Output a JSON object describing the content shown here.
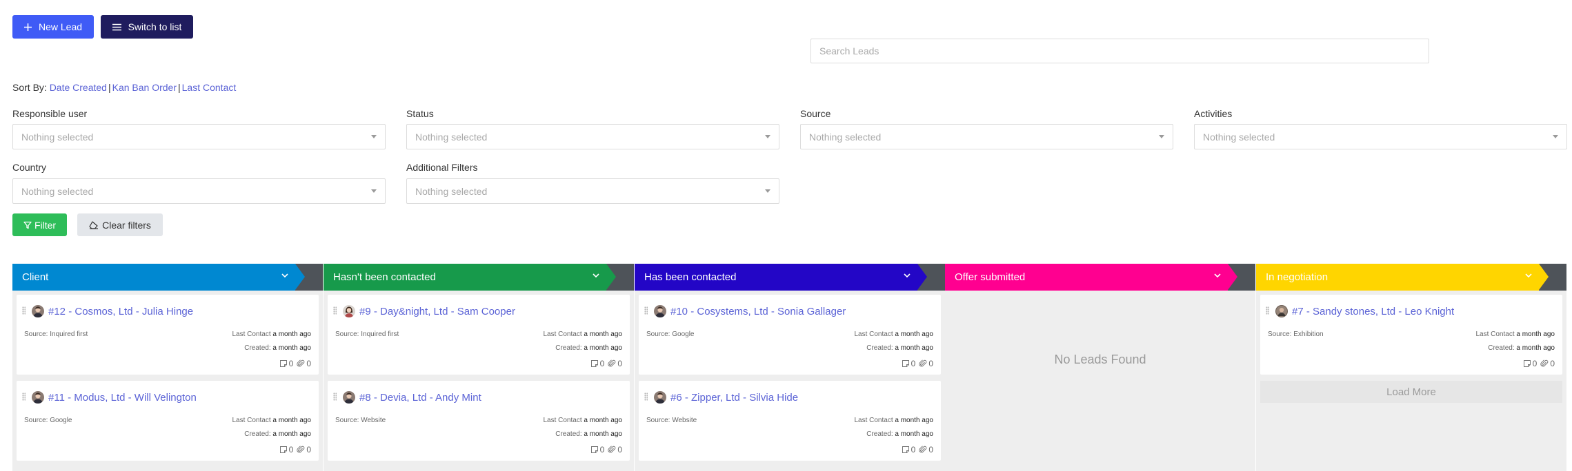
{
  "toolbar": {
    "new_lead_label": "New Lead",
    "switch_list_label": "Switch to list"
  },
  "search": {
    "placeholder": "Search Leads"
  },
  "sort": {
    "prefix": "Sort By:",
    "options": [
      "Date Created",
      "Kan Ban Order",
      "Last Contact"
    ],
    "separator": "|"
  },
  "filters": {
    "responsible_user": {
      "label": "Responsible user",
      "value": "Nothing selected"
    },
    "status": {
      "label": "Status",
      "value": "Nothing selected"
    },
    "source": {
      "label": "Source",
      "value": "Nothing selected"
    },
    "activities": {
      "label": "Activities",
      "value": "Nothing selected"
    },
    "country": {
      "label": "Country",
      "value": "Nothing selected"
    },
    "additional": {
      "label": "Additional Filters",
      "value": "Nothing selected"
    },
    "filter_label": "Filter",
    "clear_label": "Clear filters"
  },
  "card_labels": {
    "last_contact": "Last Contact",
    "created": "Created:"
  },
  "columns": [
    {
      "title": "Client",
      "color": "#0088d1",
      "leads": [
        {
          "title": "#12 - Cosmos, Ltd - Julia Hinge",
          "source": "Source: Inquired first",
          "last_contact": "a month ago",
          "created": "a month ago",
          "notes": "0",
          "attachments": "0",
          "avatar": "male"
        },
        {
          "title": "#11 - Modus, Ltd - Will Velington",
          "source": "Source: Google",
          "last_contact": "a month ago",
          "created": "a month ago",
          "notes": "0",
          "attachments": "0",
          "avatar": "male"
        }
      ]
    },
    {
      "title": "Hasn't been contacted",
      "color": "#179a4b",
      "leads": [
        {
          "title": "#9 - Day&night, Ltd - Sam Cooper",
          "source": "Source: Inquired first",
          "last_contact": "a month ago",
          "created": "a month ago",
          "notes": "0",
          "attachments": "0",
          "avatar": "female"
        },
        {
          "title": "#8 - Devia, Ltd - Andy Mint",
          "source": "Source: Website",
          "last_contact": "a month ago",
          "created": "a month ago",
          "notes": "0",
          "attachments": "0",
          "avatar": "male"
        }
      ]
    },
    {
      "title": "Has been contacted",
      "color": "#2306c6",
      "leads": [
        {
          "title": "#10 - Cosystems, Ltd - Sonia Gallager",
          "source": "Source: Google",
          "last_contact": "a month ago",
          "created": "a month ago",
          "notes": "0",
          "attachments": "0",
          "avatar": "male"
        },
        {
          "title": "#6 - Zipper, Ltd - Silvia Hide",
          "source": "Source: Website",
          "last_contact": "a month ago",
          "created": "a month ago",
          "notes": "0",
          "attachments": "0",
          "avatar": "male"
        }
      ]
    },
    {
      "title": "Offer submitted",
      "color": "#ff0090",
      "empty_text": "No Leads Found",
      "leads": []
    },
    {
      "title": "In negotiation",
      "color": "#ffd500",
      "leads": [
        {
          "title": "#7 - Sandy stones, Ltd - Leo Knight",
          "source": "Source: Exhibition",
          "last_contact": "a month ago",
          "created": "a month ago",
          "notes": "0",
          "attachments": "0",
          "avatar": "round"
        }
      ],
      "load_more": "Load More"
    }
  ]
}
